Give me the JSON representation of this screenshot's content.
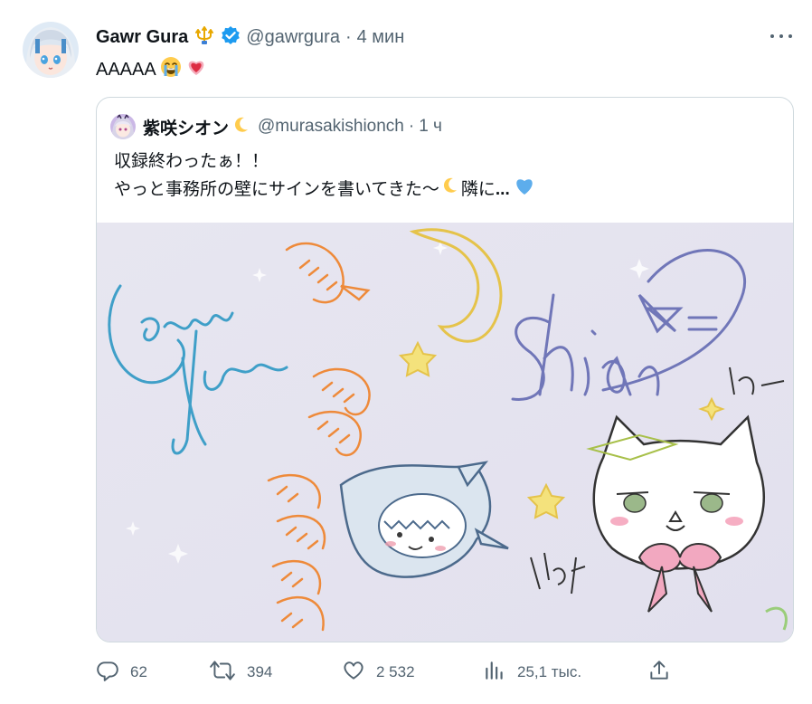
{
  "author": {
    "name": "Gawr Gura",
    "handle": "@gawrgura",
    "separator": "·",
    "time": "4 мин",
    "badge": "trident-badge-icon",
    "verified": "verified-badge-icon"
  },
  "tweet": {
    "text": "AAAAA",
    "emojis": [
      "loudly-crying-face",
      "growing-heart"
    ]
  },
  "quoted": {
    "name": "紫咲シオン",
    "name_emoji": "crescent-moon",
    "handle": "@murasakishionch",
    "separator": "·",
    "time": "1 ч",
    "line1": "収録終わったぁ！！",
    "line2": "やっと事務所の壁にサインを書いてきた〜",
    "line2_after": "隣に",
    "ellipsis": "...",
    "line2_end_emoji": "blue-heart",
    "image_alt": "wall-signatures-drawing"
  },
  "actions": {
    "replies": "62",
    "retweets": "394",
    "likes": "2 532",
    "views": "25,1 тыс."
  },
  "colors": {
    "text": "#0f1419",
    "secondary": "#536471",
    "border": "#cfd9de",
    "verified": "#1d9bf0"
  }
}
